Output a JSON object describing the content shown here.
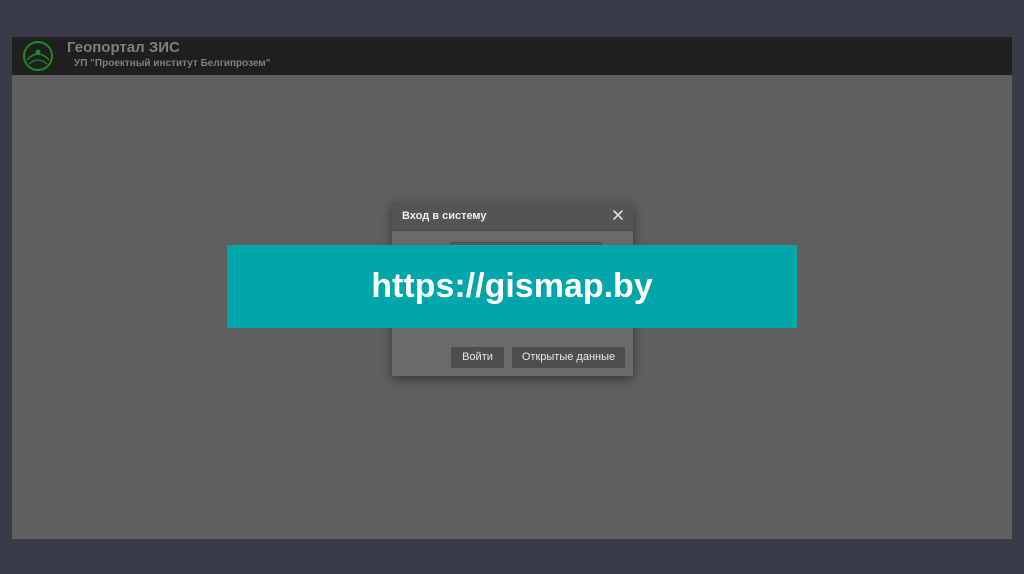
{
  "header": {
    "title": "Геопортал ЗИС",
    "subtitle": "УП \"Проектный институт Белгипрозем\"",
    "logo_icon": "belgiprozem-logo"
  },
  "dialog": {
    "title": "Вход в систему",
    "close_icon": "close-icon",
    "login_button": "Войти",
    "open_data_button": "Открытые данные"
  },
  "banner": {
    "text": "https://gismap.by"
  },
  "colors": {
    "page_background": "#393b48",
    "screen_background": "#5f5f5f",
    "header_background": "#1f1f1f",
    "logo_green": "#1f8a2a",
    "banner_background": "#00a6aa"
  }
}
